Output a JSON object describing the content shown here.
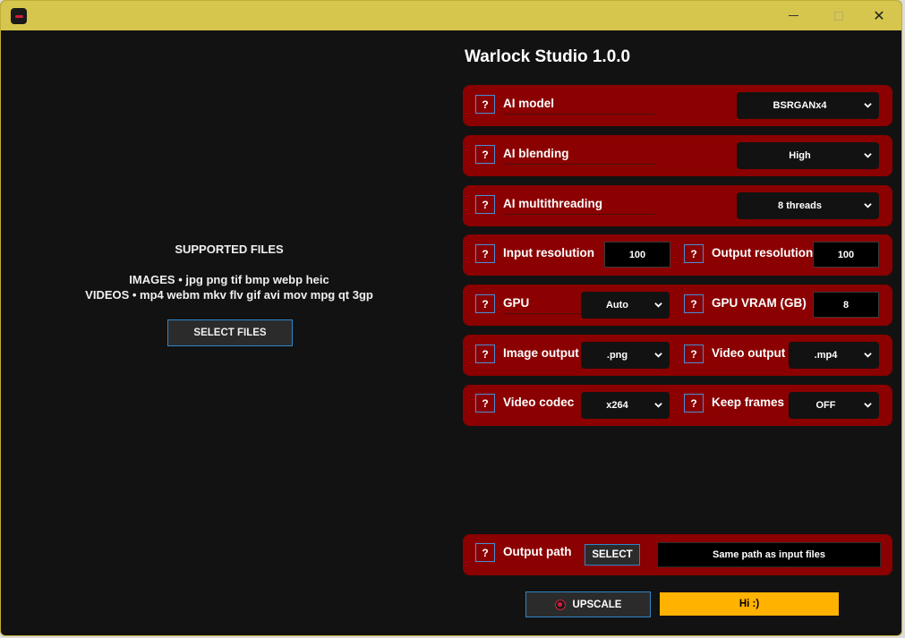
{
  "window": {
    "app_icon": "warlock-icon",
    "controls": {
      "minimize": "minimize-icon",
      "maximize": "maximize-icon",
      "close": "✕"
    }
  },
  "drop_area": {
    "title": "SUPPORTED FILES",
    "images_line": "IMAGES • jpg png tif bmp webp heic",
    "videos_line": "VIDEOS • mp4 webm mkv flv gif avi mov mpg qt 3gp",
    "select_button": "SELECT FILES"
  },
  "app_title": "Warlock Studio 1.0.0",
  "help_label": "?",
  "settings": {
    "ai_model": {
      "label": "AI model",
      "value": "BSRGANx4"
    },
    "ai_blending": {
      "label": "AI blending",
      "value": "High"
    },
    "ai_multithreading": {
      "label": "AI multithreading",
      "value": "8 threads"
    },
    "input_resolution": {
      "label": "Input resolution",
      "value": "100"
    },
    "output_resolution": {
      "label": "Output resolution",
      "value": "100"
    },
    "gpu": {
      "label": "GPU",
      "value": "Auto"
    },
    "gpu_vram": {
      "label": "GPU VRAM (GB)",
      "value": "8"
    },
    "image_output": {
      "label": "Image output",
      "value": ".png"
    },
    "video_output": {
      "label": "Video output",
      "value": ".mp4"
    },
    "video_codec": {
      "label": "Video codec",
      "value": "x264"
    },
    "keep_frames": {
      "label": "Keep frames",
      "value": "OFF"
    },
    "output_path": {
      "label": "Output path",
      "select_button": "SELECT",
      "value": "Same path as input files"
    }
  },
  "upscale_button": "UPSCALE",
  "status_message": "Hi :)",
  "colors": {
    "row_background": "#8b0000",
    "window_background": "#121212",
    "titlebar": "#d6c64d",
    "button_border": "#2d86c8",
    "status_background": "#ffb200"
  }
}
